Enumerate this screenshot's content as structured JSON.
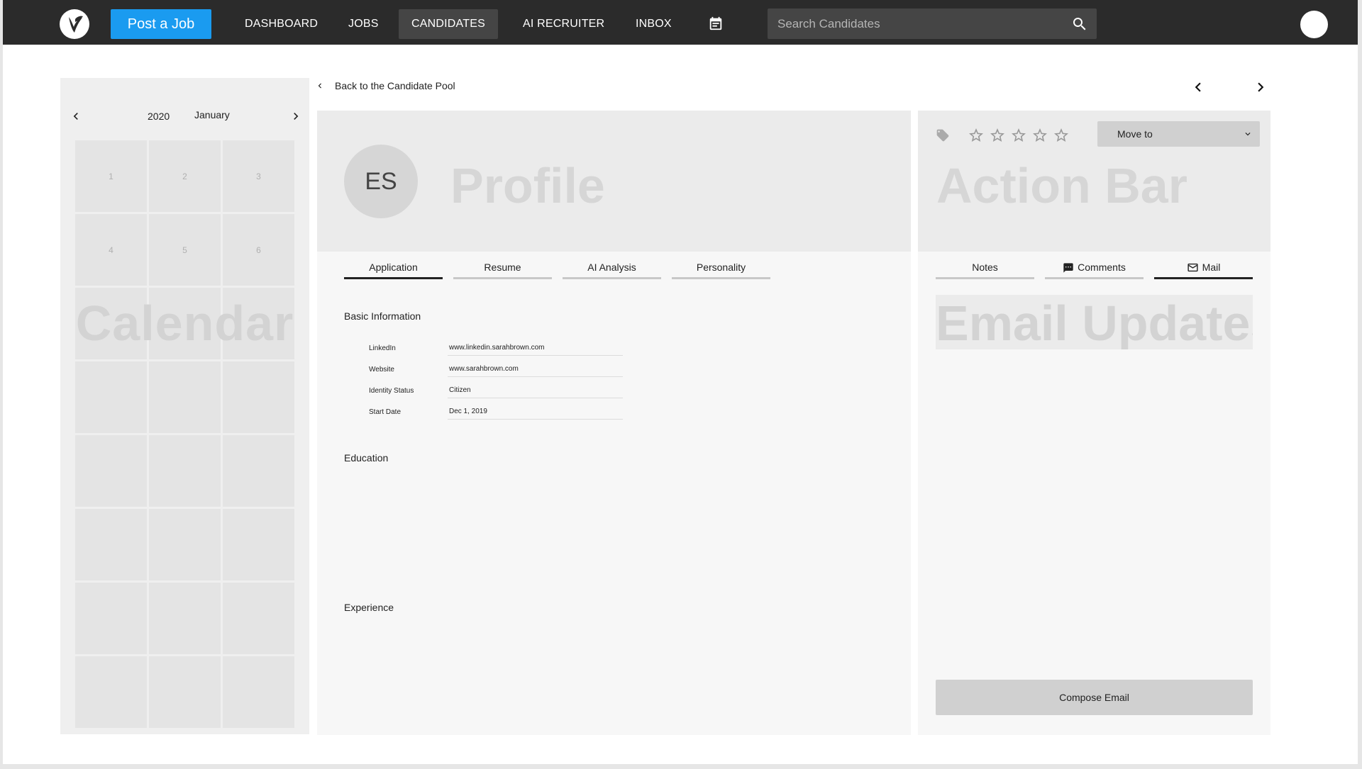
{
  "topbar": {
    "post_job_label": "Post a Job",
    "nav": [
      {
        "label": "DASHBOARD"
      },
      {
        "label": "JOBS"
      },
      {
        "label": "CANDIDATES",
        "active": true
      },
      {
        "label": "AI RECRUITER"
      },
      {
        "label": "INBOX"
      }
    ],
    "search_placeholder": "Search Candidates"
  },
  "calendar": {
    "year": "2020",
    "month": "January",
    "days": [
      "1",
      "2",
      "3",
      "4",
      "5",
      "6"
    ],
    "watermark": "Calendar"
  },
  "back_link": "Back to the Candidate Pool",
  "profile": {
    "initials": "ES",
    "watermark": "Profile",
    "tabs": [
      "Application",
      "Resume",
      "AI Analysis",
      "Personality"
    ],
    "active_tab": "Application",
    "basic_info_title": "Basic Information",
    "basic_info": [
      {
        "label": "LinkedIn",
        "value": "www.linkedin.sarahbrown.com"
      },
      {
        "label": "Website",
        "value": "www.sarahbrown.com"
      },
      {
        "label": "Identity Status",
        "value": "Citizen"
      },
      {
        "label": "Start Date",
        "value": "Dec 1, 2019"
      }
    ],
    "education_title": "Education",
    "experience_title": "Experience"
  },
  "action_bar": {
    "watermark": "Action Bar",
    "rating": 0,
    "move_to_label": "Move to",
    "tabs": [
      "Notes",
      "Comments",
      "Mail"
    ],
    "active_tab": "Mail",
    "email_watermark": "Email Updates",
    "compose_label": "Compose Email"
  },
  "colors": {
    "topbar": "#2b2b2b",
    "accent": "#1a9bf0"
  }
}
